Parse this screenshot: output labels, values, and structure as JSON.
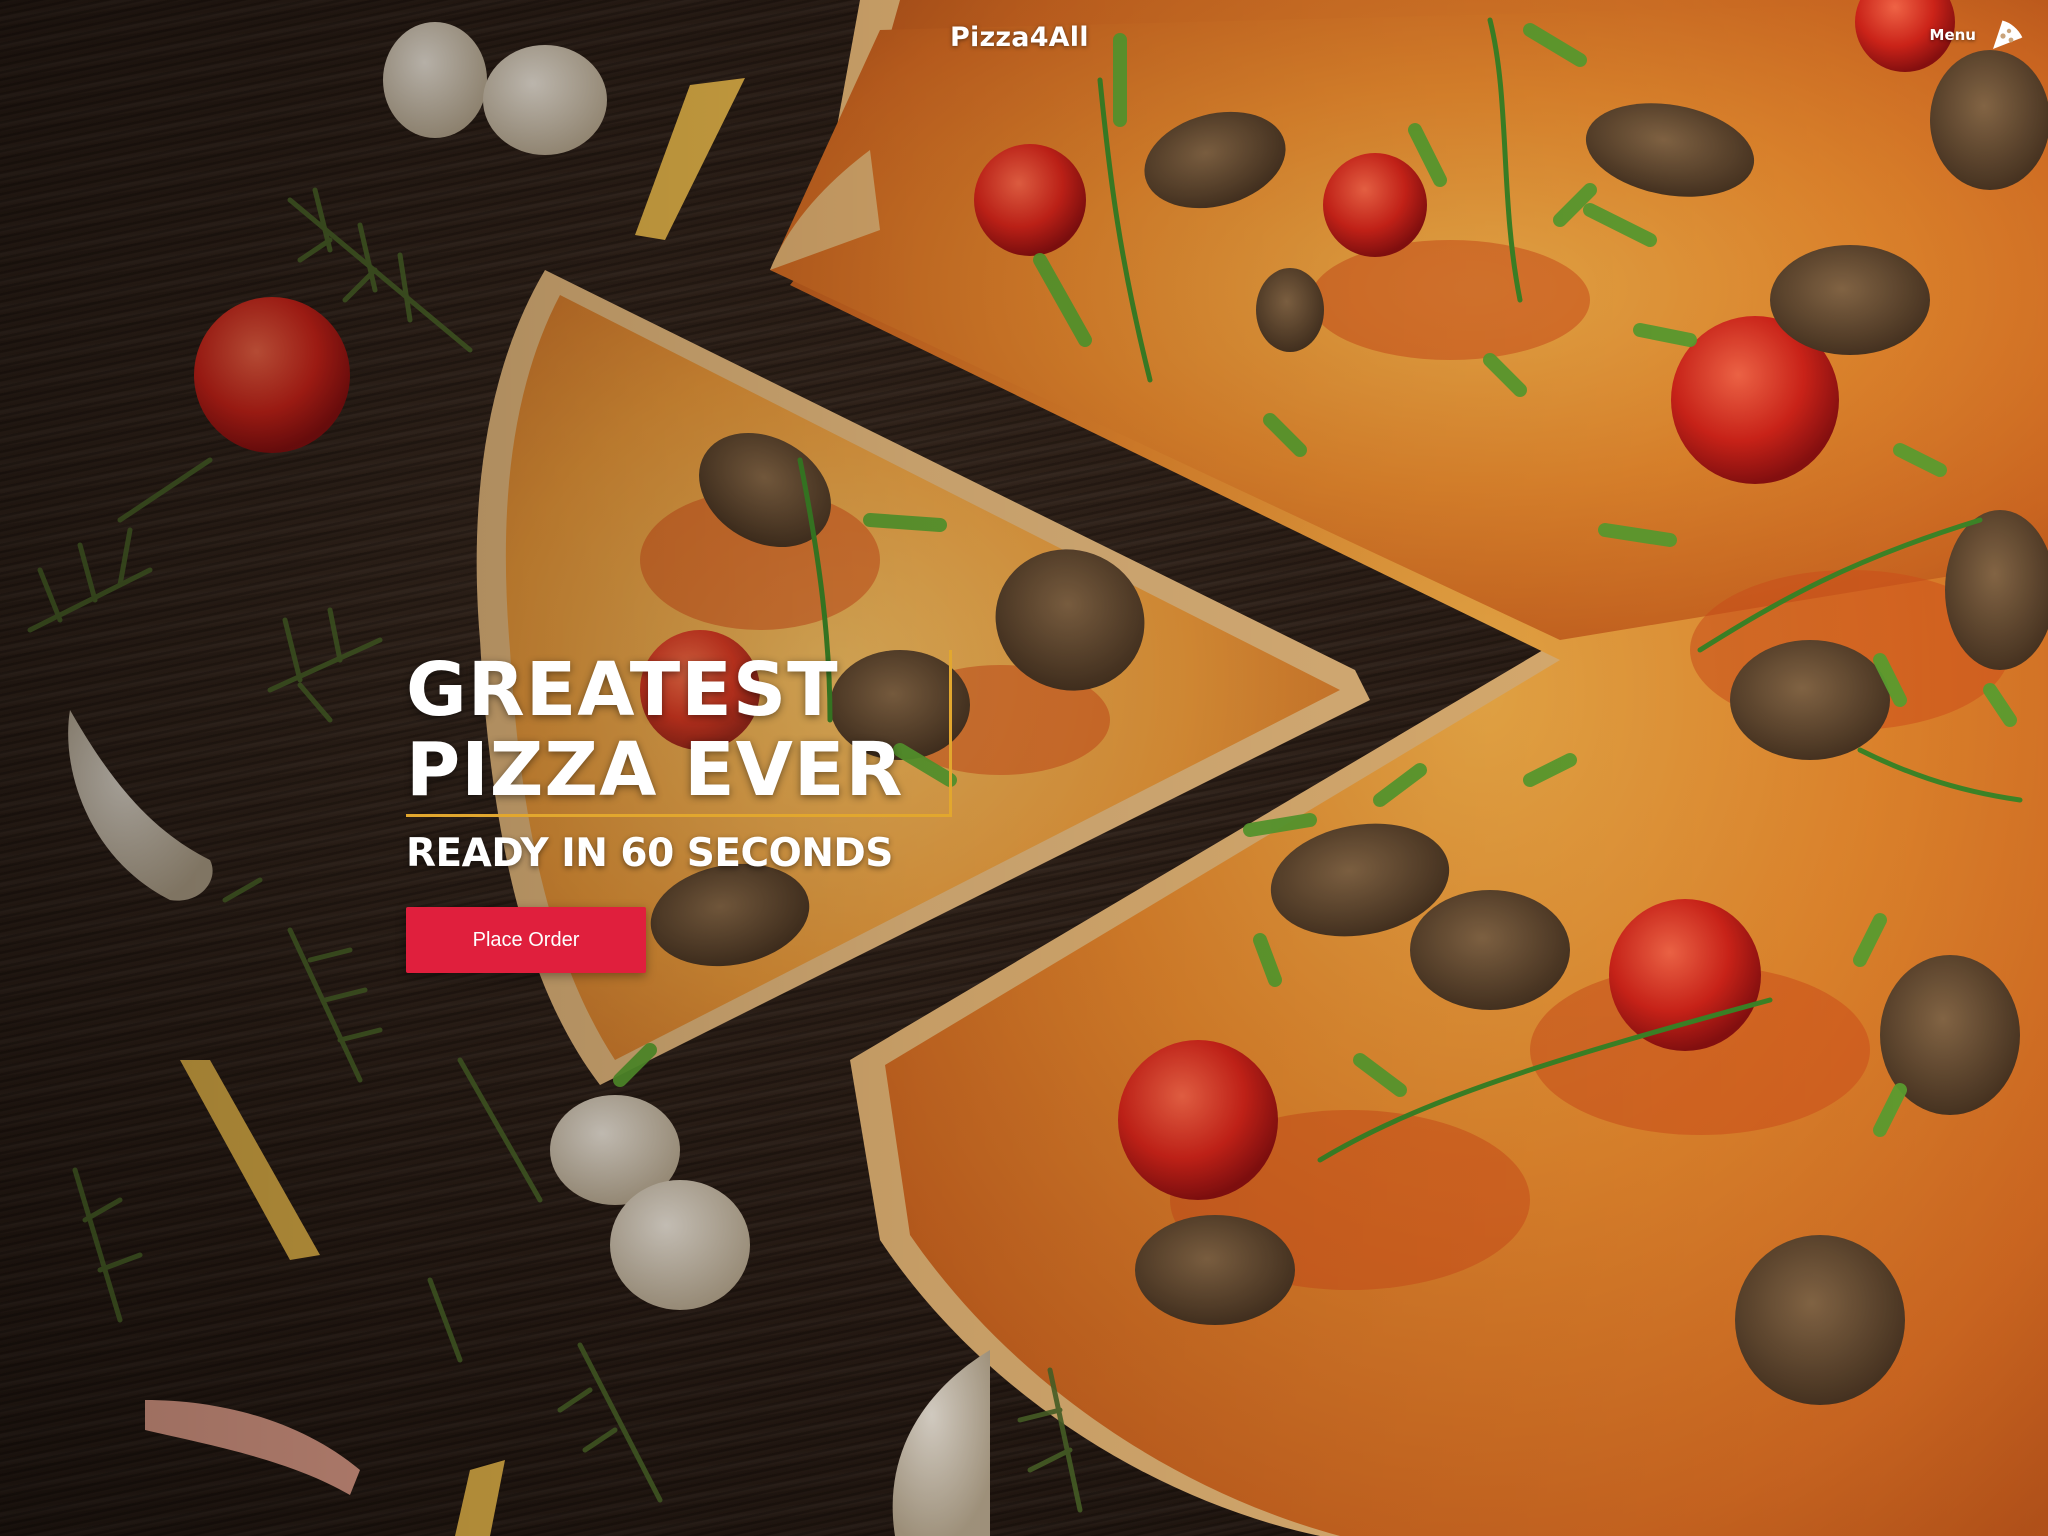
{
  "header": {
    "brand": "Pizza4All",
    "menu_label": "Menu",
    "menu_icon": "pizza-slice-icon"
  },
  "hero": {
    "headline_line1": "GREATEST",
    "headline_line2": "PIZZA EVER",
    "subheadline": "READY IN 60 SECONDS",
    "cta_label": "Place Order"
  },
  "colors": {
    "cta_background": "#e01f3d",
    "headline_accent_border": "#e2a72e",
    "text": "#ffffff"
  }
}
